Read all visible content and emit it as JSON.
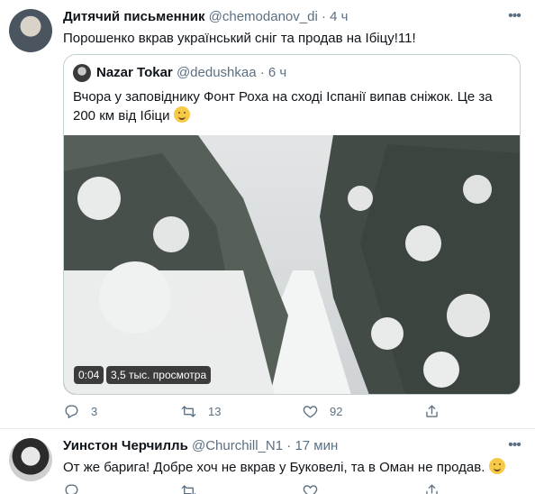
{
  "tweet1": {
    "author_name": "Дитячий письменник",
    "handle": "@chemodanov_di",
    "separator": "·",
    "time": "4 ч",
    "text": "Порошенко вкрав український сніг та продав на Ібіцу!11!",
    "quote": {
      "author_name": "Nazar Tokar",
      "handle": "@dedushkaa",
      "separator": "·",
      "time": "6 ч",
      "text": "Вчора у заповіднику Фонт Роха на сході Іспанії випав сніжок. Це за 200 км від Ібіци",
      "video": {
        "duration": "0:04",
        "views": "3,5 тыс. просмотра"
      }
    },
    "actions": {
      "reply_count": "3",
      "retweet_count": "13",
      "like_count": "92"
    }
  },
  "tweet2": {
    "author_name": "Уинстон Черчилль",
    "handle": "@Churchill_N1",
    "separator": "·",
    "time": "17 мин",
    "text": "От же барига! Добре хоч не вкрав у Буковелі, та в Оман не продав."
  },
  "icons": [
    "more-icon",
    "reply-icon",
    "retweet-icon",
    "like-icon",
    "share-icon",
    "smile-emoji",
    "grin-emoji"
  ],
  "colors": {
    "muted": "#5b7083",
    "border": "#c4cfd6",
    "text": "#0f1419"
  }
}
